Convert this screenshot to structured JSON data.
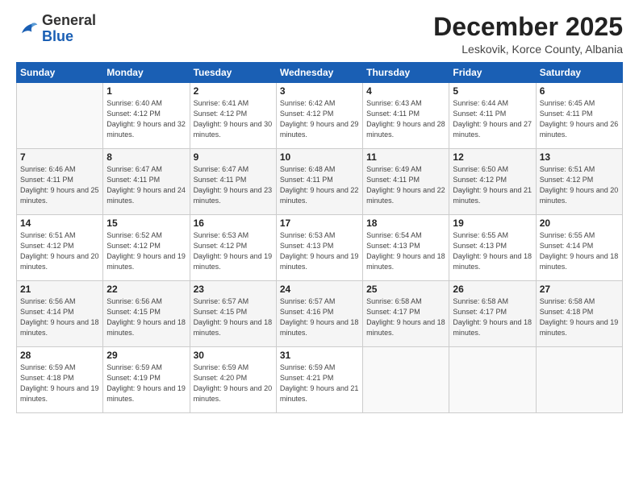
{
  "logo": {
    "general": "General",
    "blue": "Blue"
  },
  "header": {
    "month": "December 2025",
    "location": "Leskovik, Korce County, Albania"
  },
  "weekdays": [
    "Sunday",
    "Monday",
    "Tuesday",
    "Wednesday",
    "Thursday",
    "Friday",
    "Saturday"
  ],
  "weeks": [
    [
      {
        "day": "",
        "sunrise": "",
        "sunset": "",
        "daylight": ""
      },
      {
        "day": "1",
        "sunrise": "Sunrise: 6:40 AM",
        "sunset": "Sunset: 4:12 PM",
        "daylight": "Daylight: 9 hours and 32 minutes."
      },
      {
        "day": "2",
        "sunrise": "Sunrise: 6:41 AM",
        "sunset": "Sunset: 4:12 PM",
        "daylight": "Daylight: 9 hours and 30 minutes."
      },
      {
        "day": "3",
        "sunrise": "Sunrise: 6:42 AM",
        "sunset": "Sunset: 4:12 PM",
        "daylight": "Daylight: 9 hours and 29 minutes."
      },
      {
        "day": "4",
        "sunrise": "Sunrise: 6:43 AM",
        "sunset": "Sunset: 4:11 PM",
        "daylight": "Daylight: 9 hours and 28 minutes."
      },
      {
        "day": "5",
        "sunrise": "Sunrise: 6:44 AM",
        "sunset": "Sunset: 4:11 PM",
        "daylight": "Daylight: 9 hours and 27 minutes."
      },
      {
        "day": "6",
        "sunrise": "Sunrise: 6:45 AM",
        "sunset": "Sunset: 4:11 PM",
        "daylight": "Daylight: 9 hours and 26 minutes."
      }
    ],
    [
      {
        "day": "7",
        "sunrise": "Sunrise: 6:46 AM",
        "sunset": "Sunset: 4:11 PM",
        "daylight": "Daylight: 9 hours and 25 minutes."
      },
      {
        "day": "8",
        "sunrise": "Sunrise: 6:47 AM",
        "sunset": "Sunset: 4:11 PM",
        "daylight": "Daylight: 9 hours and 24 minutes."
      },
      {
        "day": "9",
        "sunrise": "Sunrise: 6:47 AM",
        "sunset": "Sunset: 4:11 PM",
        "daylight": "Daylight: 9 hours and 23 minutes."
      },
      {
        "day": "10",
        "sunrise": "Sunrise: 6:48 AM",
        "sunset": "Sunset: 4:11 PM",
        "daylight": "Daylight: 9 hours and 22 minutes."
      },
      {
        "day": "11",
        "sunrise": "Sunrise: 6:49 AM",
        "sunset": "Sunset: 4:11 PM",
        "daylight": "Daylight: 9 hours and 22 minutes."
      },
      {
        "day": "12",
        "sunrise": "Sunrise: 6:50 AM",
        "sunset": "Sunset: 4:12 PM",
        "daylight": "Daylight: 9 hours and 21 minutes."
      },
      {
        "day": "13",
        "sunrise": "Sunrise: 6:51 AM",
        "sunset": "Sunset: 4:12 PM",
        "daylight": "Daylight: 9 hours and 20 minutes."
      }
    ],
    [
      {
        "day": "14",
        "sunrise": "Sunrise: 6:51 AM",
        "sunset": "Sunset: 4:12 PM",
        "daylight": "Daylight: 9 hours and 20 minutes."
      },
      {
        "day": "15",
        "sunrise": "Sunrise: 6:52 AM",
        "sunset": "Sunset: 4:12 PM",
        "daylight": "Daylight: 9 hours and 19 minutes."
      },
      {
        "day": "16",
        "sunrise": "Sunrise: 6:53 AM",
        "sunset": "Sunset: 4:12 PM",
        "daylight": "Daylight: 9 hours and 19 minutes."
      },
      {
        "day": "17",
        "sunrise": "Sunrise: 6:53 AM",
        "sunset": "Sunset: 4:13 PM",
        "daylight": "Daylight: 9 hours and 19 minutes."
      },
      {
        "day": "18",
        "sunrise": "Sunrise: 6:54 AM",
        "sunset": "Sunset: 4:13 PM",
        "daylight": "Daylight: 9 hours and 18 minutes."
      },
      {
        "day": "19",
        "sunrise": "Sunrise: 6:55 AM",
        "sunset": "Sunset: 4:13 PM",
        "daylight": "Daylight: 9 hours and 18 minutes."
      },
      {
        "day": "20",
        "sunrise": "Sunrise: 6:55 AM",
        "sunset": "Sunset: 4:14 PM",
        "daylight": "Daylight: 9 hours and 18 minutes."
      }
    ],
    [
      {
        "day": "21",
        "sunrise": "Sunrise: 6:56 AM",
        "sunset": "Sunset: 4:14 PM",
        "daylight": "Daylight: 9 hours and 18 minutes."
      },
      {
        "day": "22",
        "sunrise": "Sunrise: 6:56 AM",
        "sunset": "Sunset: 4:15 PM",
        "daylight": "Daylight: 9 hours and 18 minutes."
      },
      {
        "day": "23",
        "sunrise": "Sunrise: 6:57 AM",
        "sunset": "Sunset: 4:15 PM",
        "daylight": "Daylight: 9 hours and 18 minutes."
      },
      {
        "day": "24",
        "sunrise": "Sunrise: 6:57 AM",
        "sunset": "Sunset: 4:16 PM",
        "daylight": "Daylight: 9 hours and 18 minutes."
      },
      {
        "day": "25",
        "sunrise": "Sunrise: 6:58 AM",
        "sunset": "Sunset: 4:17 PM",
        "daylight": "Daylight: 9 hours and 18 minutes."
      },
      {
        "day": "26",
        "sunrise": "Sunrise: 6:58 AM",
        "sunset": "Sunset: 4:17 PM",
        "daylight": "Daylight: 9 hours and 18 minutes."
      },
      {
        "day": "27",
        "sunrise": "Sunrise: 6:58 AM",
        "sunset": "Sunset: 4:18 PM",
        "daylight": "Daylight: 9 hours and 19 minutes."
      }
    ],
    [
      {
        "day": "28",
        "sunrise": "Sunrise: 6:59 AM",
        "sunset": "Sunset: 4:18 PM",
        "daylight": "Daylight: 9 hours and 19 minutes."
      },
      {
        "day": "29",
        "sunrise": "Sunrise: 6:59 AM",
        "sunset": "Sunset: 4:19 PM",
        "daylight": "Daylight: 9 hours and 19 minutes."
      },
      {
        "day": "30",
        "sunrise": "Sunrise: 6:59 AM",
        "sunset": "Sunset: 4:20 PM",
        "daylight": "Daylight: 9 hours and 20 minutes."
      },
      {
        "day": "31",
        "sunrise": "Sunrise: 6:59 AM",
        "sunset": "Sunset: 4:21 PM",
        "daylight": "Daylight: 9 hours and 21 minutes."
      },
      {
        "day": "",
        "sunrise": "",
        "sunset": "",
        "daylight": ""
      },
      {
        "day": "",
        "sunrise": "",
        "sunset": "",
        "daylight": ""
      },
      {
        "day": "",
        "sunrise": "",
        "sunset": "",
        "daylight": ""
      }
    ]
  ]
}
